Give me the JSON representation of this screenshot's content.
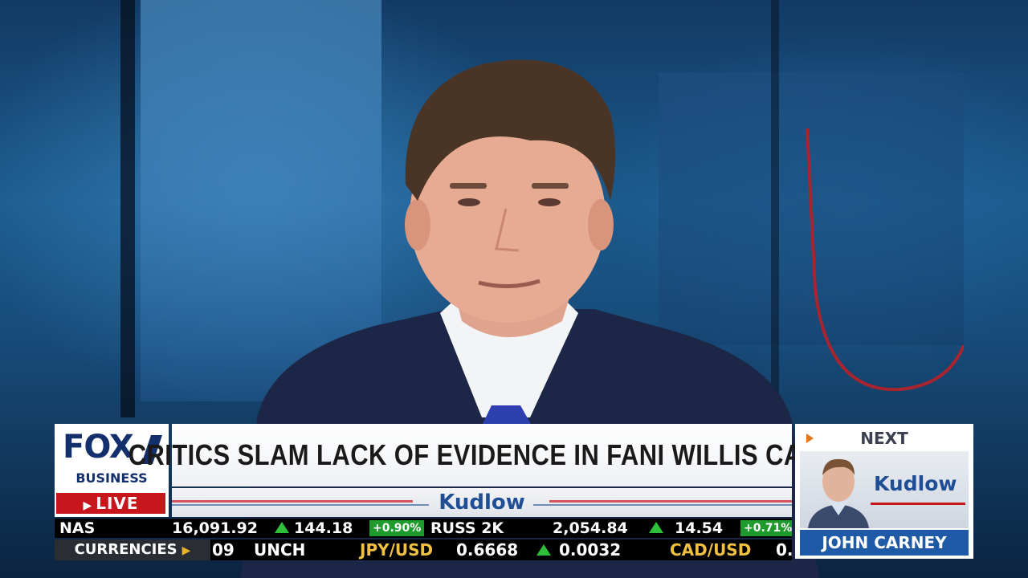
{
  "headline": "CRITICS SLAM LACK OF EVIDENCE IN FANI WILLIS CASE",
  "show": "Kudlow",
  "network": {
    "logo_top": "FOX",
    "logo_bottom": "BUSINESS",
    "live": "LIVE"
  },
  "next": {
    "label": "NEXT",
    "show": "Kudlow",
    "host": "JOHN CARNEY"
  },
  "ticker": {
    "nas": {
      "symbol": "NAS",
      "value": "16,091.92",
      "change": "144.18",
      "pct": "+0.90%"
    },
    "russ": {
      "symbol": "RUSS 2K",
      "value": "2,054.84",
      "change": "14.54",
      "pct": "+0.71%"
    },
    "currencies_label": "CURRENCIES",
    "fragment": "09",
    "unch": "UNCH",
    "jpy": {
      "pair": "JPY/USD",
      "value": "0.6668",
      "change": "0.0032"
    },
    "cad": {
      "pair": "CAD/USD",
      "value": "0."
    }
  },
  "colors": {
    "fox_navy": "#13306c",
    "live_red": "#c8161d",
    "kudlow_blue": "#1f4e94",
    "up_green": "#2fbf3a",
    "currency_gold": "#f0c040"
  }
}
